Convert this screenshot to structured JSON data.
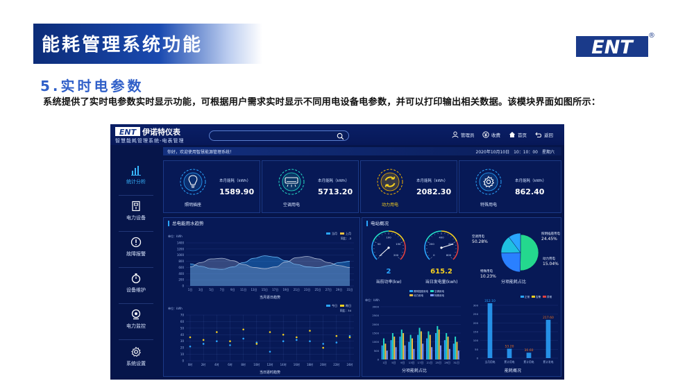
{
  "slide": {
    "banner_title": "能耗管理系统功能",
    "section_title": "5.实时电参数",
    "description": "系统提供了实时电参数实时显示功能，可根据用户需求实时显示不同用电设备电参数，并可以打印输出相关数据。该模块界面如图所示：",
    "logo_text": "ENT",
    "logo_registered": "®",
    "brand_blue": "#1a3a8a"
  },
  "app": {
    "logo_text": "ENT",
    "name": "伊诺特仪表",
    "subtitle": "智慧能耗管理系统-电表管理",
    "search": {
      "placeholder": ""
    },
    "header_items": [
      {
        "icon": "user-icon",
        "label": "管理员"
      },
      {
        "icon": "yen-icon",
        "label": "收费"
      },
      {
        "icon": "home-icon",
        "label": "首页"
      },
      {
        "icon": "return-icon",
        "label": "返回"
      }
    ],
    "welcome": "你好，欢迎使用智慧能源管理系统！",
    "datetime": "2020年10月10日　10：10：00　星期六",
    "sidebar": [
      {
        "icon": "bar-chart-icon",
        "label": "统计分析",
        "active": true
      },
      {
        "icon": "power-device-icon",
        "label": "电力设备",
        "active": false
      },
      {
        "icon": "alert-icon",
        "label": "故障报警",
        "active": false
      },
      {
        "icon": "maintenance-icon",
        "label": "设备维护",
        "active": false
      },
      {
        "icon": "monitor-icon",
        "label": "电力监控",
        "active": false
      },
      {
        "icon": "gear-icon",
        "label": "系统设置",
        "active": false
      }
    ],
    "kpis": [
      {
        "icon": "bulb-icon",
        "name": "照明插座",
        "label": "本月能耗（kWh）",
        "value": "1589.90",
        "accent": "#2aa6ff"
      },
      {
        "icon": "aircon-icon",
        "name": "空调用电",
        "label": "本月能耗（kWh）",
        "value": "5713.20",
        "accent": "#24e0c8"
      },
      {
        "icon": "cycle-icon",
        "name": "动力用电",
        "label": "本月能耗（kWh）",
        "value": "2082.30",
        "accent": "#f5b400"
      },
      {
        "icon": "gear-icon",
        "name": "特殊用电",
        "label": "本月能耗（kWh）",
        "value": "862.40",
        "accent": "#2aa6ff"
      }
    ],
    "panels": {
      "trend_title": "总电能用水趋势",
      "overview_title": "电站概况"
    }
  },
  "chart_data": [
    {
      "type": "area",
      "title": "",
      "ylabel": "单位：kWh",
      "caption": "当月逐日趋势",
      "ylim": [
        0,
        1400
      ],
      "yticks": [
        0,
        200,
        400,
        600,
        800,
        1000,
        1200,
        1400
      ],
      "categories": [
        "1日",
        "3日",
        "5日",
        "7日",
        "9日",
        "11日",
        "13日",
        "15日",
        "17日",
        "19日",
        "21日",
        "23日",
        "25日",
        "27日",
        "29日",
        "31日"
      ],
      "series": [
        {
          "name": "当月",
          "color": "#2aa6ff",
          "values": [
            720,
            640,
            560,
            540,
            620,
            760,
            900,
            980,
            940,
            820,
            700,
            620,
            600,
            660,
            760,
            800
          ]
        },
        {
          "name": "上月",
          "color": "#f0c040",
          "values": [
            620,
            760,
            880,
            900,
            820,
            700,
            600,
            560,
            620,
            780,
            920,
            960,
            880,
            760,
            660,
            600
          ]
        }
      ],
      "legend_note": "同比：-3"
    },
    {
      "type": "line",
      "title": "",
      "ylabel": "单位：kWh",
      "caption": "当日逐时趋势",
      "ylim": [
        0,
        70
      ],
      "yticks": [
        0,
        10,
        20,
        30,
        40,
        50,
        60,
        70
      ],
      "categories": [
        "0时",
        "2时",
        "4时",
        "6时",
        "8时",
        "10时",
        "12时",
        "14时",
        "16时",
        "18时",
        "20时",
        "22时",
        "24时"
      ],
      "series": [
        {
          "name": "今日",
          "color": "#2aa6ff",
          "values": [
            22,
            26,
            30,
            24,
            34,
            28,
            14,
            30,
            32,
            30,
            26,
            28,
            38
          ]
        },
        {
          "name": "昨日",
          "color": "#f5d020",
          "values": [
            36,
            32,
            44,
            30,
            48,
            26,
            44,
            40,
            36,
            46,
            20,
            38,
            36
          ]
        }
      ],
      "legend_note": "同比：34"
    },
    {
      "type": "gauge",
      "caption": "当前功率(kw)",
      "value": 2,
      "display": "2",
      "min": 0,
      "max": 200,
      "ticks": [
        0,
        50,
        100,
        150,
        200
      ],
      "value_color": "#2aa6ff"
    },
    {
      "type": "gauge",
      "caption": "当日发电量(kwh)",
      "value": 615.2,
      "display": "615.2",
      "min": 0,
      "max": 800,
      "ticks": [
        0,
        200,
        400,
        600,
        800
      ],
      "value_color": "#f5d020"
    },
    {
      "type": "pie",
      "caption": "分项能耗占比",
      "slices": [
        {
          "name": "空调用电",
          "percent": 50.28,
          "label": "50.28%",
          "color": "#24d88e"
        },
        {
          "name": "照明插座用电",
          "percent": 24.45,
          "label": "24.45%",
          "color": "#2a80ff"
        },
        {
          "name": "动力用电",
          "percent": 15.04,
          "label": "15.04%",
          "color": "#1fc0e0"
        },
        {
          "name": "特殊用电",
          "percent": 10.23,
          "label": "10.23%",
          "color": "#2aa6ff"
        }
      ]
    },
    {
      "type": "bar",
      "ylabel": "单位：kWh",
      "caption": "分项能耗占比",
      "ylim": [
        0,
        3000
      ],
      "yticks": [
        0,
        500,
        1000,
        1500,
        2000,
        2500,
        3000
      ],
      "categories": [
        "1日",
        "5日",
        "9日",
        "13日",
        "17日",
        "21日",
        "25日",
        "29日",
        "31日"
      ],
      "series": [
        {
          "name": "照明插座用电",
          "color": "#2aa6ff",
          "values": [
            800,
            1100,
            1300,
            1000,
            1400,
            1200,
            1500,
            1100,
            900
          ]
        },
        {
          "name": "空调用电",
          "color": "#24d8c8",
          "values": [
            1200,
            1500,
            1700,
            1400,
            1800,
            1600,
            1900,
            1500,
            1300
          ]
        },
        {
          "name": "动力用电",
          "color": "#f0c040",
          "values": [
            900,
            1300,
            1500,
            1200,
            1600,
            1400,
            1700,
            1300,
            1000
          ]
        },
        {
          "name": "特殊用电",
          "color": "#7e9cff",
          "values": [
            500,
            700,
            800,
            600,
            900,
            700,
            800,
            600,
            500
          ]
        }
      ]
    },
    {
      "type": "bar",
      "caption": "能耗概况",
      "ylim": [
        0,
        300
      ],
      "yticks": [
        0,
        50,
        100,
        150,
        200,
        250,
        300
      ],
      "categories": [
        "当月用电",
        "累计用电",
        "累计用电",
        "累计发电"
      ],
      "legend": [
        "正常",
        "告警",
        "异常"
      ],
      "legend_colors": [
        "#2aa6ff",
        "#f5d020",
        "#e04040"
      ],
      "series": [
        {
          "name": "",
          "color": "#2aa6ff",
          "values": [
            312.1,
            53.2,
            30.6,
            217.6
          ]
        }
      ],
      "value_labels": [
        "312.10",
        "53.20",
        "30.60",
        "217.60"
      ],
      "label_colors": [
        "#2aa6ff",
        "#f07020",
        "#f07020",
        "#f07020"
      ]
    }
  ]
}
